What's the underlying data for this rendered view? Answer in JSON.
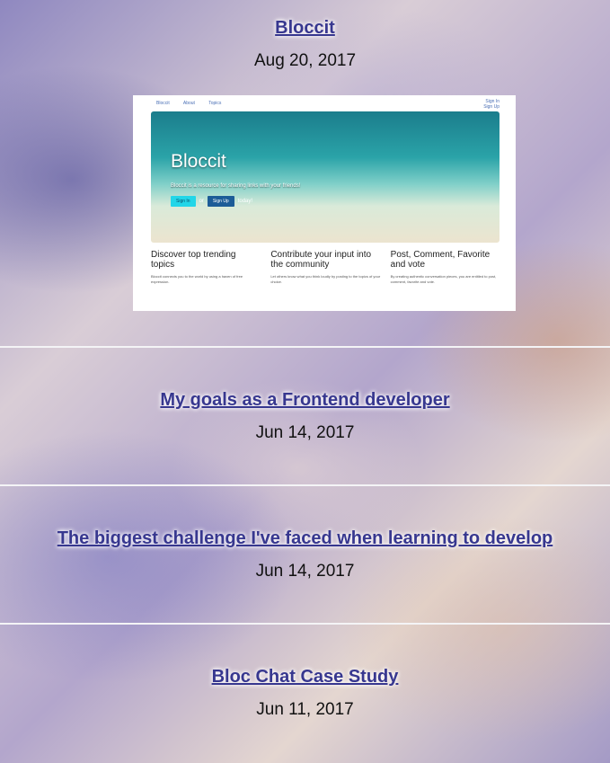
{
  "posts": [
    {
      "title": "Bloccit",
      "date": "Aug 20, 2017"
    },
    {
      "title": "My goals as a Frontend developer",
      "date": "Jun 14, 2017"
    },
    {
      "title": "The biggest challenge I've faced when learning to develop",
      "date": "Jun 14, 2017"
    },
    {
      "title": "Bloc Chat Case Study",
      "date": "Jun 11, 2017"
    }
  ],
  "screenshot": {
    "nav": [
      "Bloccit",
      "About",
      "Topics"
    ],
    "auth": [
      "Sign In",
      "Sign Up"
    ],
    "hero_title": "Bloccit",
    "hero_tagline": "Bloccit is a resource for sharing links with your friends!",
    "sign_in": "Sign In",
    "or": "or",
    "sign_up": "Sign Up",
    "today": "today!",
    "columns": [
      {
        "heading": "Discover top trending topics",
        "text": "Bloccit connects you to the world by using a haven of free expression."
      },
      {
        "heading": "Contribute your input into the community",
        "text": "Let others know what you think loudly by posting to the topics of your choice."
      },
      {
        "heading": "Post, Comment, Favorite and vote",
        "text": "By creating authentic conversation pieces, you are entitled to post, comment, favorite and vote."
      }
    ]
  },
  "colors": {
    "link": "#37378f",
    "divider": "#f4f4f6",
    "text": "#111111"
  }
}
